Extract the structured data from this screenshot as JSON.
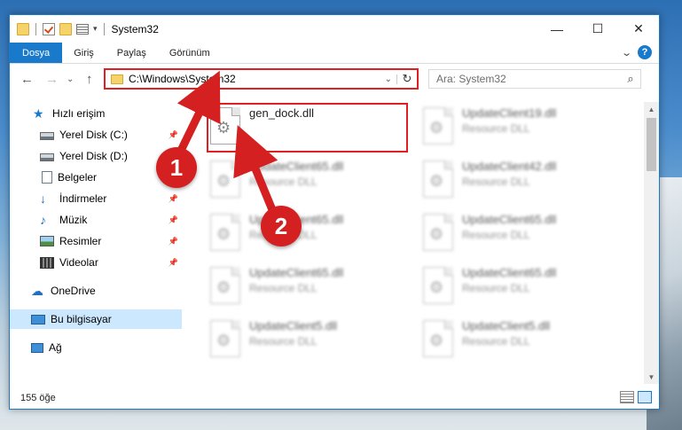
{
  "window": {
    "title": "System32",
    "controls": {
      "minimize": "—",
      "maximize": "☐",
      "close": "✕"
    }
  },
  "ribbon": {
    "tabs": [
      "Dosya",
      "Giriş",
      "Paylaş",
      "Görünüm"
    ],
    "help": "?"
  },
  "nav": {
    "back": "←",
    "forward": "→",
    "recent": "⌄",
    "up": "↑",
    "address": "C:\\Windows\\System32",
    "refresh": "↻",
    "search_placeholder": "Ara: System32"
  },
  "sidebar": {
    "items": [
      {
        "label": "Hızlı erişim",
        "icon": "star-icon",
        "pinned": false
      },
      {
        "label": "Yerel Disk (C:)",
        "icon": "drive-icon",
        "pinned": true
      },
      {
        "label": "Yerel Disk (D:)",
        "icon": "drive-icon",
        "pinned": false
      },
      {
        "label": "Belgeler",
        "icon": "document-icon",
        "pinned": true
      },
      {
        "label": "İndirmeler",
        "icon": "download-icon",
        "pinned": true
      },
      {
        "label": "Müzik",
        "icon": "music-icon",
        "pinned": true
      },
      {
        "label": "Resimler",
        "icon": "pictures-icon",
        "pinned": true
      },
      {
        "label": "Videolar",
        "icon": "video-icon",
        "pinned": true
      },
      {
        "label": "OneDrive",
        "icon": "cloud-icon",
        "pinned": false
      },
      {
        "label": "Bu bilgisayar",
        "icon": "computer-icon",
        "pinned": false,
        "active": true
      },
      {
        "label": "Ağ",
        "icon": "network-icon",
        "pinned": false
      }
    ]
  },
  "files": [
    {
      "name": "gen_dock.dll",
      "type": "",
      "highlighted": true
    },
    {
      "name": "UpdateClient19.dll",
      "type": "Resource DLL"
    },
    {
      "name": "UpdateClient65.dll",
      "type": "Resource DLL"
    },
    {
      "name": "UpdateClient42.dll",
      "type": "Resource DLL"
    },
    {
      "name": "UpdateClient65.dll",
      "type": "Resource DLL"
    },
    {
      "name": "UpdateClient65.dll",
      "type": "Resource DLL"
    },
    {
      "name": "UpdateClient65.dll",
      "type": "Resource DLL"
    },
    {
      "name": "UpdateClient65.dll",
      "type": "Resource DLL"
    },
    {
      "name": "UpdateClient5.dll",
      "type": "Resource DLL"
    },
    {
      "name": "UpdateClient5.dll",
      "type": "Resource DLL"
    }
  ],
  "status": {
    "count": "155 öğe"
  },
  "annotations": {
    "step1": "1",
    "step2": "2",
    "color": "#d42020"
  }
}
